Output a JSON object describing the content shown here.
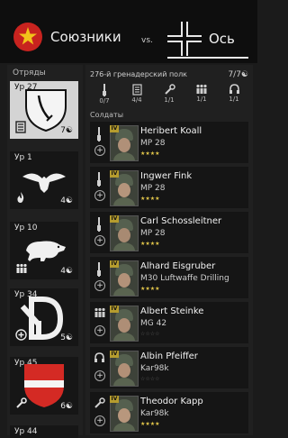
{
  "header": {
    "allies_label": "Союзники",
    "vs_label": "vs.",
    "axis_label": "Ось"
  },
  "squads_header": "Отряды",
  "squads": [
    {
      "level": "Ур 27",
      "count": "7",
      "emblem": "shield-sword-emblem",
      "icon": "list-icon",
      "selected": true
    },
    {
      "level": "Ур 1",
      "count": "4",
      "emblem": "eagle-emblem",
      "icon": "flame-icon",
      "selected": false
    },
    {
      "level": "Ур 10",
      "count": "4",
      "emblem": "boar-emblem",
      "icon": "squad-icon",
      "selected": false
    },
    {
      "level": "Ур 34",
      "count": "5",
      "emblem": "letter-d-emblem",
      "icon": "medic-icon",
      "selected": false
    },
    {
      "level": "Ур 45",
      "count": "6",
      "emblem": "red-white-shield-emblem",
      "icon": "wrench-icon",
      "selected": false
    },
    {
      "level": "Ур 44",
      "count": "",
      "emblem": "",
      "icon": "",
      "selected": false
    }
  ],
  "unit": {
    "name": "276-й гренадерский полк",
    "count": "7/7",
    "slots": [
      {
        "icon": "rifle-icon",
        "value": "0/7"
      },
      {
        "icon": "list-icon",
        "value": "4/4"
      },
      {
        "icon": "wrench-icon",
        "value": "1/1"
      },
      {
        "icon": "squad-icon",
        "value": "1/1"
      },
      {
        "icon": "headphones-icon",
        "value": "1/1"
      }
    ]
  },
  "soldiers_header": "Солдаты",
  "soldiers": [
    {
      "name": "Heribert Koall",
      "weapon": "MP 28",
      "rank": "IV",
      "role": "rifle-icon",
      "stars": "★★★★",
      "dim": false
    },
    {
      "name": "Ingwer Fink",
      "weapon": "MP 28",
      "rank": "IV",
      "role": "rifle-icon",
      "stars": "★★★★",
      "dim": false
    },
    {
      "name": "Carl Schossleitner",
      "weapon": "MP 28",
      "rank": "IV",
      "role": "rifle-icon",
      "stars": "★★★★",
      "dim": false
    },
    {
      "name": "Alhard Eisgruber",
      "weapon": "M30 Luftwaffe Drilling",
      "rank": "IV",
      "role": "rifle-icon",
      "stars": "★★★★",
      "dim": false
    },
    {
      "name": "Albert Steinke",
      "weapon": "MG 42",
      "rank": "IV",
      "role": "squad-icon",
      "stars": "☆☆☆☆",
      "dim": true
    },
    {
      "name": "Albin Pfeiffer",
      "weapon": "Kar98k",
      "rank": "IV",
      "role": "headphones-icon",
      "stars": "☆☆☆☆",
      "dim": true
    },
    {
      "name": "Theodor Kapp",
      "weapon": "Kar98k",
      "rank": "IV",
      "role": "wrench-icon",
      "stars": "★★★★",
      "dim": false
    }
  ],
  "colors": {
    "allies_red": "#c8231f",
    "star_gold": "#e2c64a",
    "rank_gold": "#b59c2e"
  }
}
